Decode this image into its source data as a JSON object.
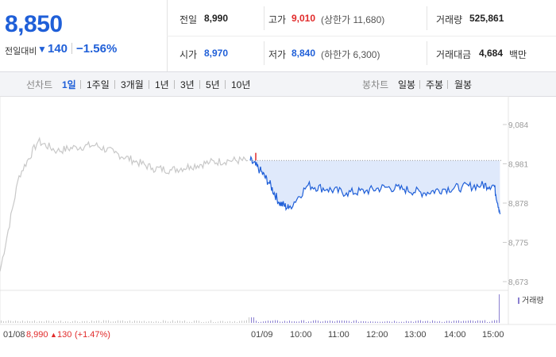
{
  "summary": {
    "price": "8,850",
    "change_label": "전일대비",
    "change_arrow": "▼",
    "change_value": "140",
    "change_pct": "−1.56%"
  },
  "stats": {
    "prev_label": "전일",
    "prev_value": "8,990",
    "high_label": "고가",
    "high_value": "9,010",
    "high_limit": "(상한가 11,680)",
    "volume_label": "거래량",
    "volume_value": "525,861",
    "open_label": "시가",
    "open_value": "8,970",
    "low_label": "저가",
    "low_value": "8,840",
    "low_limit": "(하한가 6,300)",
    "amount_label": "거래대금",
    "amount_value": "4,684",
    "amount_unit": "백만"
  },
  "toolbar": {
    "line_label": "선차트",
    "line_periods": [
      "1일",
      "1주일",
      "3개월",
      "1년",
      "3년",
      "5년",
      "10년"
    ],
    "candle_label": "봉차트",
    "candle_periods": [
      "일봉",
      "주봉",
      "월봉"
    ]
  },
  "colors": {
    "blue": "#1f5fd8",
    "red": "#e12a2a",
    "grey_line": "#c8c8c8"
  },
  "chart_data": {
    "type": "line",
    "y_ticks": [
      "9,084",
      "8,981",
      "8,878",
      "8,775",
      "8,673"
    ],
    "ylim": [
      8673,
      9084
    ],
    "prev_close": 8990,
    "x_ticks": [
      "01/08",
      "01/09",
      "10:00",
      "11:00",
      "12:00",
      "13:00",
      "14:00",
      "15:00"
    ],
    "prev_day_footer": {
      "date": "01/08",
      "close": "8,990",
      "arrow": "▲",
      "change": "130",
      "pct": "(+1.47%)"
    },
    "volume_legend": "거래량",
    "series": [
      {
        "name": "01/08",
        "x": [
          "09:00",
          "09:30",
          "10:00",
          "10:30",
          "11:00",
          "11:30",
          "12:00",
          "12:30",
          "13:00",
          "13:30",
          "14:00",
          "14:30",
          "15:00",
          "15:30"
        ],
        "values": [
          8700,
          8950,
          9040,
          9015,
          9025,
          9030,
          9010,
          8990,
          8970,
          8965,
          8975,
          8985,
          8990,
          8990
        ]
      },
      {
        "name": "01/09",
        "x": [
          "09:00",
          "09:15",
          "09:30",
          "09:45",
          "10:00",
          "10:30",
          "11:00",
          "11:30",
          "12:00",
          "12:30",
          "13:00",
          "13:30",
          "14:00",
          "14:30",
          "15:00",
          "15:20",
          "15:30"
        ],
        "values": [
          8990,
          8965,
          8930,
          8880,
          8865,
          8925,
          8915,
          8905,
          8910,
          8920,
          8915,
          8905,
          8915,
          8920,
          8925,
          8925,
          8850
        ]
      }
    ]
  }
}
